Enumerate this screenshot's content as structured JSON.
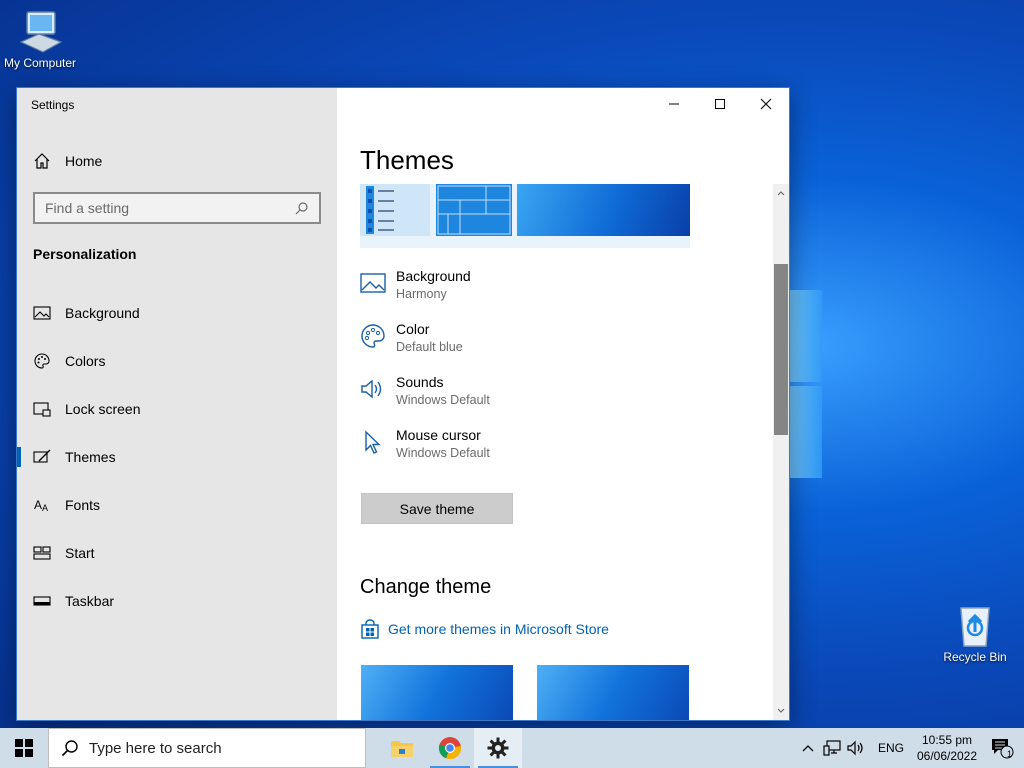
{
  "desktop": {
    "icons": [
      {
        "label": "My Computer",
        "icon": "computer-icon"
      },
      {
        "label": "Recycle Bin",
        "icon": "recycle-bin-icon"
      }
    ]
  },
  "window": {
    "app_title": "Settings",
    "sidebar": {
      "home_label": "Home",
      "search_placeholder": "Find a setting",
      "section_heading": "Personalization",
      "items": [
        {
          "label": "Background",
          "icon": "image-icon"
        },
        {
          "label": "Colors",
          "icon": "palette-icon"
        },
        {
          "label": "Lock screen",
          "icon": "lock-screen-icon"
        },
        {
          "label": "Themes",
          "icon": "brush-icon",
          "active": true
        },
        {
          "label": "Fonts",
          "icon": "font-icon"
        },
        {
          "label": "Start",
          "icon": "start-icon"
        },
        {
          "label": "Taskbar",
          "icon": "taskbar-icon"
        }
      ]
    },
    "content": {
      "title": "Themes",
      "properties": [
        {
          "label": "Background",
          "value": "Harmony",
          "icon": "image-icon"
        },
        {
          "label": "Color",
          "value": "Default blue",
          "icon": "palette-icon"
        },
        {
          "label": "Sounds",
          "value": "Windows Default",
          "icon": "speaker-icon"
        },
        {
          "label": "Mouse cursor",
          "value": "Windows Default",
          "icon": "cursor-icon"
        }
      ],
      "save_button": "Save theme",
      "change_heading": "Change theme",
      "store_link": "Get more themes in Microsoft Store"
    }
  },
  "taskbar": {
    "search_placeholder": "Type here to search",
    "apps": [
      {
        "name": "File Explorer",
        "icon": "folder-icon"
      },
      {
        "name": "Chrome",
        "icon": "chrome-icon"
      },
      {
        "name": "Settings",
        "icon": "gear-icon"
      }
    ],
    "language": "ENG",
    "time": "10:55 pm",
    "date": "06/06/2022",
    "notification_count": "1"
  },
  "colors": {
    "accent": "#0063b1",
    "desktop": "#0a62d8",
    "sidebar_bg": "#e6e6e6",
    "taskbar_bg": "#cfdde8"
  }
}
